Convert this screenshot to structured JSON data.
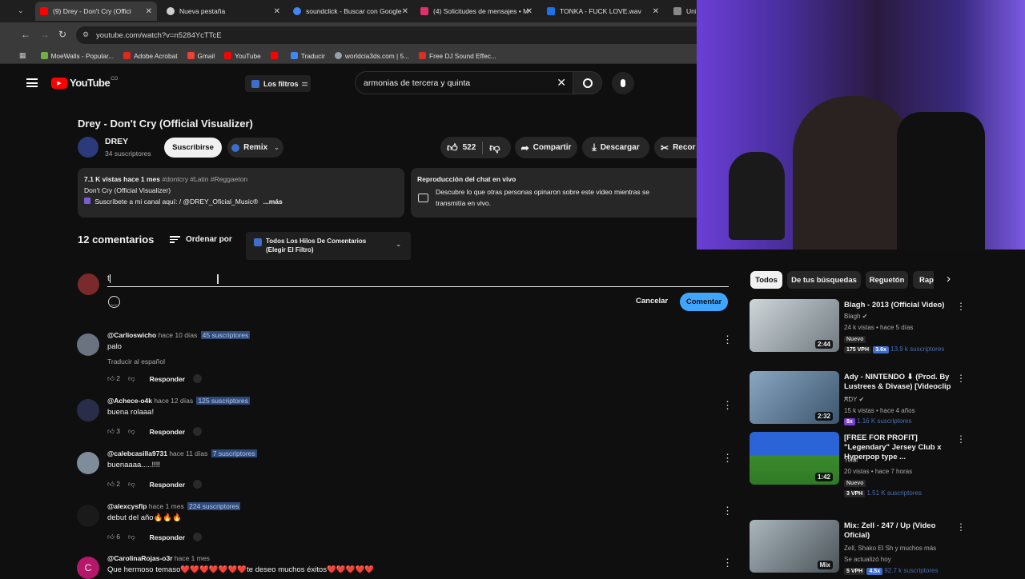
{
  "tabs": [
    {
      "label": "(9) Drey - Don't Cry (Offici",
      "color": "#ff0000"
    },
    {
      "label": "Nueva pestaña",
      "color": "#cfcfcf"
    },
    {
      "label": "soundclick - Buscar con Google",
      "color": "#4285f4"
    },
    {
      "label": "(4) Solicitudes de mensajes • M",
      "color": "#e1306c"
    },
    {
      "label": "TONKA - FUCK LOVE.wav",
      "color": "#1a73e8"
    },
    {
      "label": "Uni",
      "color": "#888"
    }
  ],
  "address": {
    "url": "youtube.com/watch?v=n5284YcTTcE"
  },
  "bookmarks": [
    {
      "label": "MoeWalls - Popular...",
      "color": "#6fae4a"
    },
    {
      "label": "Adobe Acrobat",
      "color": "#e0291b"
    },
    {
      "label": "Gmail",
      "color": "#ea4335"
    },
    {
      "label": "YouTube",
      "color": "#ff0000"
    },
    {
      "label": "",
      "color": "#ff0000"
    },
    {
      "label": "Traducir",
      "color": "#4285f4"
    },
    {
      "label": "worldcia3ds.com | 5...",
      "color": "#9aa0a6"
    },
    {
      "label": "Free DJ Sound Effec...",
      "color": "#d93025"
    }
  ],
  "yt": {
    "logo": "YouTube",
    "country": "CO",
    "filters": "Los filtros",
    "search_value": "armonias de tercera y quinta"
  },
  "video": {
    "title": "Drey - Don't Cry (Official Visualizer)",
    "channel": "DREY",
    "subs": "34 suscriptores",
    "subscribe": "Suscribirse",
    "remix": "Remix",
    "likes": "522",
    "share": "Compartir",
    "download": "Descargar",
    "clip": "Recor"
  },
  "description": {
    "stats": "7.1 K vistas  hace 1 mes",
    "tags": "#dontcry #Latin #Reggaeton",
    "line2": "Don't Cry (Official Visualizer)",
    "line3": "Suscríbete a mi canal aquí:  / @DREY_Oficial_Music®",
    "more": "...más"
  },
  "chat": {
    "title": "Reproducción del chat en vivo",
    "text1": "Descubre lo que otras personas opinaron sobre este video mientras se",
    "text2": "transmitía en vivo."
  },
  "comments_header": {
    "count": "12 comentarios",
    "sort": "Ordenar por",
    "filter1": "Todos Los Hilos De Comentarios",
    "filter2": "(Elegir El Filtro)"
  },
  "composer": {
    "value": "t",
    "cancel": "Cancelar",
    "submit": "Comentar"
  },
  "comments": [
    {
      "handle": "@Carlioswicho",
      "ago": "hace 10 días",
      "subs": "45 suscriptores",
      "text": "palo",
      "translate": "Traducir al español",
      "likes": "2",
      "reply": "Responder",
      "avatar": "#6b7380"
    },
    {
      "handle": "@Achece-o4k",
      "ago": "hace 12 días",
      "subs": "125 suscriptores",
      "text": "buena rolaaa!",
      "likes": "3",
      "reply": "Responder",
      "avatar": "#2a2d4a"
    },
    {
      "handle": "@calebcasilla9731",
      "ago": "hace 11 días",
      "subs": "7 suscriptores",
      "text": "buenaaaa.....!!!!",
      "likes": "2",
      "reply": "Responder",
      "avatar": "#7f8c99"
    },
    {
      "handle": "@alexcysflp",
      "ago": "hace 1 mes",
      "subs": "224 suscriptores",
      "text": "debut del año🔥🔥🔥",
      "likes": "6",
      "reply": "Responder",
      "avatar": "#1a1a1a"
    },
    {
      "handle": "@CarolinaRojas-o3r",
      "ago": "hace 1 mes",
      "subs": "",
      "text": "Que hermoso temaso❤️❤️❤️❤️❤️❤️❤️te deseo muchos éxitos❤️❤️❤️❤️❤️",
      "avatar": "#b5186b",
      "initial": "C"
    }
  ],
  "chips": [
    "Todos",
    "De tus búsquedas",
    "Reguetón",
    "Rap"
  ],
  "recs": [
    {
      "title": "Blagh - 2013 (Official Video)",
      "channel": "Blagh",
      "views": "24 k vistas • hace 5 días",
      "tag": "Nuevo",
      "vph": "175 VPH",
      "mult": "3.6x",
      "subs": "13.9 k suscriptores",
      "dur": "2:44",
      "color": "#9aa3a8"
    },
    {
      "title": "Ady - NINTENDO ⬇ (Prod. By Lustrees & Divase) [Videoclip ...",
      "channel": "ADY",
      "views": "15 k vistas • hace 4 años",
      "tag": "",
      "vph": "",
      "mult": "8x",
      "subs": "1.16 K suscriptores",
      "dur": "2:32",
      "color": "#6f8fae"
    },
    {
      "title": "[FREE FOR PROFIT] \"Legendary\" Jersey Club x Hyperpop type ...",
      "channel": "Yelbi",
      "views": "20 vistas • hace 7 horas",
      "tag": "Nuevo",
      "vph": "3 VPH",
      "mult": "",
      "subs": "1.51 K suscriptores",
      "dur": "1:42",
      "color": "#3b8a2e"
    },
    {
      "title": "Mix: Zell - 247 / Up (Video Oficial)",
      "channel": "Zell, Shako El Sh y muchos más",
      "views": "Se actualizó hoy",
      "tag": "",
      "vph": "5 VPH",
      "mult": "4.5x",
      "subs": "92.7 k suscriptores",
      "dur": "Mix",
      "color": "#8a9aa3"
    }
  ]
}
